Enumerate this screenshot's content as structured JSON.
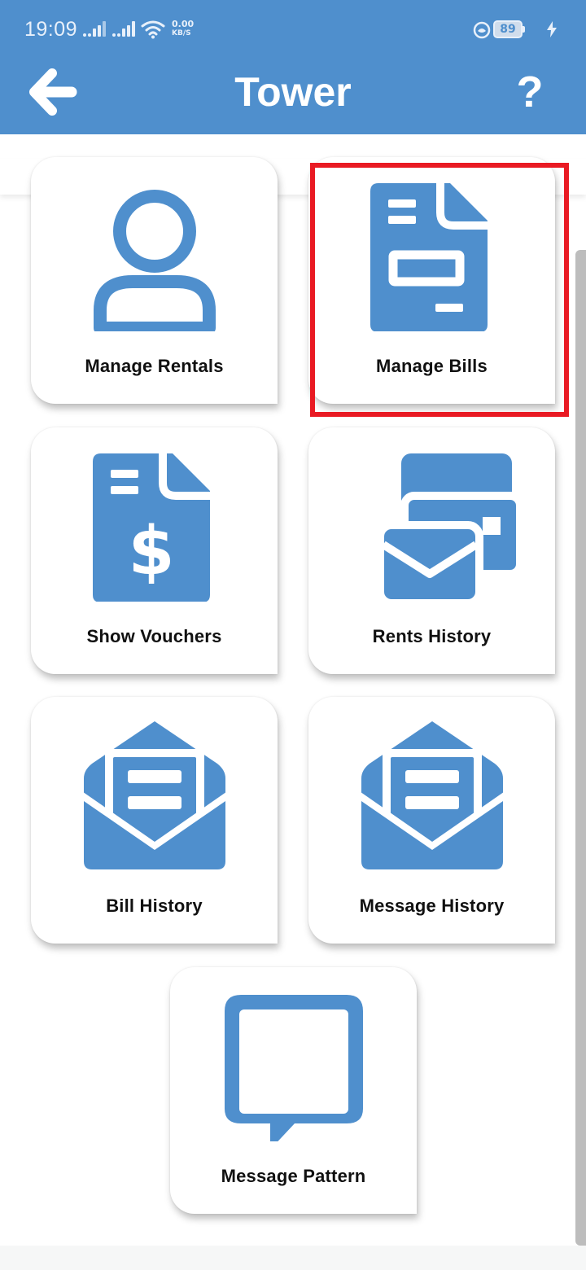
{
  "status_bar": {
    "time": "19:09",
    "net_speed_value": "0.00",
    "net_speed_unit": "KB/S",
    "battery": "89"
  },
  "header": {
    "title": "Tower",
    "back_icon": "arrow-left-icon",
    "help_icon": "help-icon",
    "help_glyph": "?"
  },
  "menu": {
    "items": [
      {
        "label": "Manage Rentals",
        "icon": "person-icon"
      },
      {
        "label": "Manage Bills",
        "icon": "bill-document-icon",
        "highlighted": true
      },
      {
        "label": "Show Vouchers",
        "icon": "voucher-dollar-icon"
      },
      {
        "label": "Rents History",
        "icon": "mail-cards-icon"
      },
      {
        "label": "Bill History",
        "icon": "open-envelope-icon"
      },
      {
        "label": "Message History",
        "icon": "open-envelope-icon"
      },
      {
        "label": "Message Pattern",
        "icon": "chat-bubble-icon"
      }
    ]
  },
  "colors": {
    "accent": "#4f8fcd",
    "highlight": "#e91a23",
    "label_text": "#111111"
  }
}
